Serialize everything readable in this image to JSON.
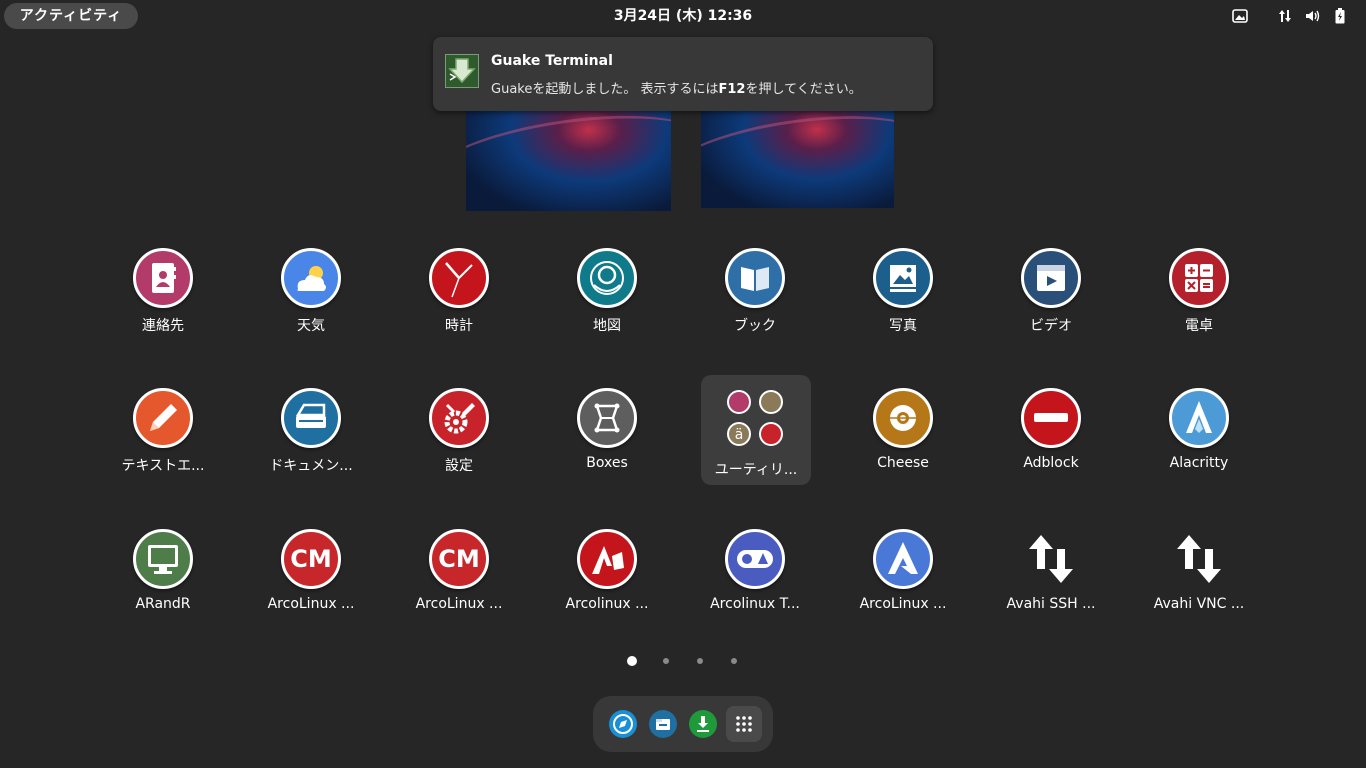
{
  "topbar": {
    "activities_label": "アクティビティ",
    "clock": "3月24日 (木)  12:36",
    "tray_icons": [
      "screenshot-icon",
      "network-icon",
      "volume-icon",
      "battery-icon"
    ]
  },
  "notification": {
    "title": "Guake Terminal",
    "body_prefix": "Guakeを起動しました。 表示するには",
    "body_key": "F12",
    "body_suffix": "を押してください。",
    "icon": "guake-icon"
  },
  "apps": {
    "row1": [
      {
        "label": "連絡先",
        "icon": "contacts-icon",
        "color": "#b33b6a"
      },
      {
        "label": "天気",
        "icon": "weather-icon",
        "color": "#4a86e8"
      },
      {
        "label": "時計",
        "icon": "clock-icon",
        "color": "#c4151c"
      },
      {
        "label": "地図",
        "icon": "maps-icon",
        "color": "#0f7a8a"
      },
      {
        "label": "ブック",
        "icon": "books-icon",
        "color": "#2f6fa8"
      },
      {
        "label": "写真",
        "icon": "photos-icon",
        "color": "#1c5f8c"
      },
      {
        "label": "ビデオ",
        "icon": "videos-icon",
        "color": "#2a4f78"
      },
      {
        "label": "電卓",
        "icon": "calculator-icon",
        "color": "#b5202d"
      }
    ],
    "row2": [
      {
        "label": "テキストエ...",
        "icon": "text-editor-icon",
        "color": "#e5582d"
      },
      {
        "label": "ドキュメン...",
        "icon": "document-scanner-icon",
        "color": "#1f6fa0"
      },
      {
        "label": "設定",
        "icon": "settings-icon",
        "color": "#c8232b"
      },
      {
        "label": "Boxes",
        "icon": "boxes-icon",
        "color": "#5e5e5e"
      },
      {
        "label": "ユーティリ...",
        "icon": "utilities-folder-icon",
        "color": "#3d3d3d"
      },
      {
        "label": "Cheese",
        "icon": "cheese-icon",
        "color": "#b57718"
      },
      {
        "label": "Adblock",
        "icon": "adblock-icon",
        "color": "#c4151c"
      },
      {
        "label": "Alacritty",
        "icon": "alacritty-icon",
        "color": "#4d9bd6"
      }
    ],
    "row3": [
      {
        "label": "ARandR",
        "icon": "arandr-icon",
        "color": "#4f7d4a"
      },
      {
        "label": "ArcoLinux ...",
        "icon": "arcolinux-cm-icon",
        "color": "#c7262a"
      },
      {
        "label": "ArcoLinux ...",
        "icon": "arcolinux-cm-icon",
        "color": "#c7262a"
      },
      {
        "label": "Arcolinux ...",
        "icon": "arcolinux-tweak-icon",
        "color": "#c4151c"
      },
      {
        "label": "Arcolinux T...",
        "icon": "arcolinux-tool-icon",
        "color": "#4a5cbf"
      },
      {
        "label": "ArcoLinux ...",
        "icon": "arcolinux-icon",
        "color": "#4a78d6"
      },
      {
        "label": "Avahi SSH ...",
        "icon": "avahi-ssh-icon",
        "color": "#262626"
      },
      {
        "label": "Avahi VNC ...",
        "icon": "avahi-vnc-icon",
        "color": "#262626"
      }
    ]
  },
  "page_indicator": {
    "current": 1,
    "total": 4
  },
  "dash": {
    "items": [
      {
        "icon": "browser-icon",
        "color": "#1a8fd6"
      },
      {
        "icon": "files-icon",
        "color": "#1f6fa0"
      },
      {
        "icon": "download-icon",
        "color": "#1f9a3a"
      }
    ],
    "show_apps_icon": "app-grid-icon"
  }
}
